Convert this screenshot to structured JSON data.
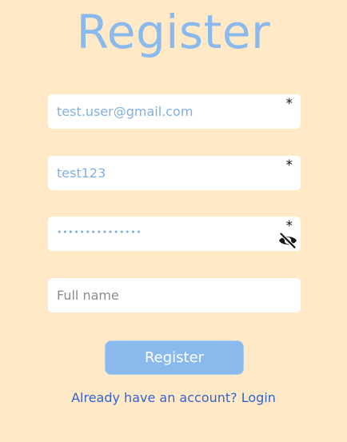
{
  "page": {
    "title": "Register",
    "background_color": "#FFE9C7",
    "accent_color": "#8AB9EE",
    "link_color": "#3563C9"
  },
  "form": {
    "email": {
      "value": "test.user@gmail.com",
      "required_marker": "*"
    },
    "username": {
      "value": "test123",
      "required_marker": "*"
    },
    "password": {
      "value": "•••••••••••••••",
      "required_marker": "*",
      "toggle_icon": "eye-off-icon"
    },
    "full_name": {
      "placeholder": "Full name"
    },
    "submit_label": "Register"
  },
  "footer": {
    "login_link": "Already have an account? Login"
  }
}
